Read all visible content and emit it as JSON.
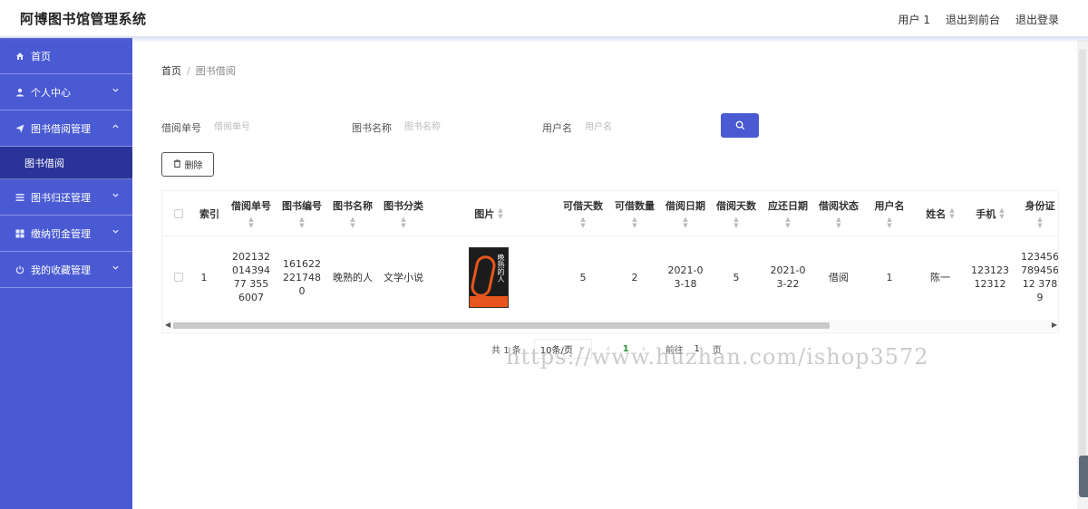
{
  "app": {
    "title": "阿博图书馆管理系统"
  },
  "header": {
    "links": [
      "用户 1",
      "退出到前台",
      "退出登录"
    ]
  },
  "sidebar": {
    "items": [
      {
        "label": "首页",
        "icon": "home-icon",
        "expandable": false
      },
      {
        "label": "个人中心",
        "icon": "user-icon",
        "expandable": true
      },
      {
        "label": "图书借阅管理",
        "icon": "paper-plane-icon",
        "expandable": true,
        "expanded": true
      },
      {
        "label": "图书归还管理",
        "icon": "list-icon",
        "expandable": true
      },
      {
        "label": "缴纳罚金管理",
        "icon": "grid-icon",
        "expandable": true
      },
      {
        "label": "我的收藏管理",
        "icon": "power-icon",
        "expandable": true
      }
    ],
    "submenu": {
      "label": "图书借阅"
    }
  },
  "breadcrumb": {
    "home": "首页",
    "current": "图书借阅"
  },
  "search": {
    "fields": [
      {
        "label": "借阅单号",
        "placeholder": "借阅单号"
      },
      {
        "label": "图书名称",
        "placeholder": "图书名称"
      },
      {
        "label": "用户名",
        "placeholder": "用户名"
      }
    ]
  },
  "toolbar": {
    "delete_label": "删除"
  },
  "table": {
    "columns": [
      "索引",
      "借阅单号",
      "图书编号",
      "图书名称",
      "图书分类",
      "图片",
      "可借天数",
      "可借数量",
      "借阅日期",
      "借阅天数",
      "应还日期",
      "借阅状态",
      "用户名",
      "姓名",
      "手机",
      "身份证"
    ],
    "rows": [
      {
        "index": "1",
        "borrow_no": "20213201439477 3556007",
        "book_no": "1616222217480",
        "book_name": "晚熟的人",
        "category": "文学小说",
        "image_title": "晚熟的人",
        "borrow_limit_days": "5",
        "borrow_qty": "2",
        "borrow_date": "2021-03-18",
        "borrow_days": "5",
        "due_date": "2021-03-22",
        "status": "借阅",
        "username": "1",
        "name": "陈一",
        "phone": "12312312312",
        "id_card": "12345678945612 3789"
      }
    ]
  },
  "pagination": {
    "total": "共 1 条",
    "page_size": "10条/页",
    "current_page": "1",
    "goto_label": "前往",
    "goto_value": "1",
    "page_unit": "页"
  },
  "watermark": "https://www.huzhan.com/ishop3572",
  "colors": {
    "accent": "#4a5ad3",
    "submenu_active": "#2a3498",
    "page_active": "#28963a"
  }
}
